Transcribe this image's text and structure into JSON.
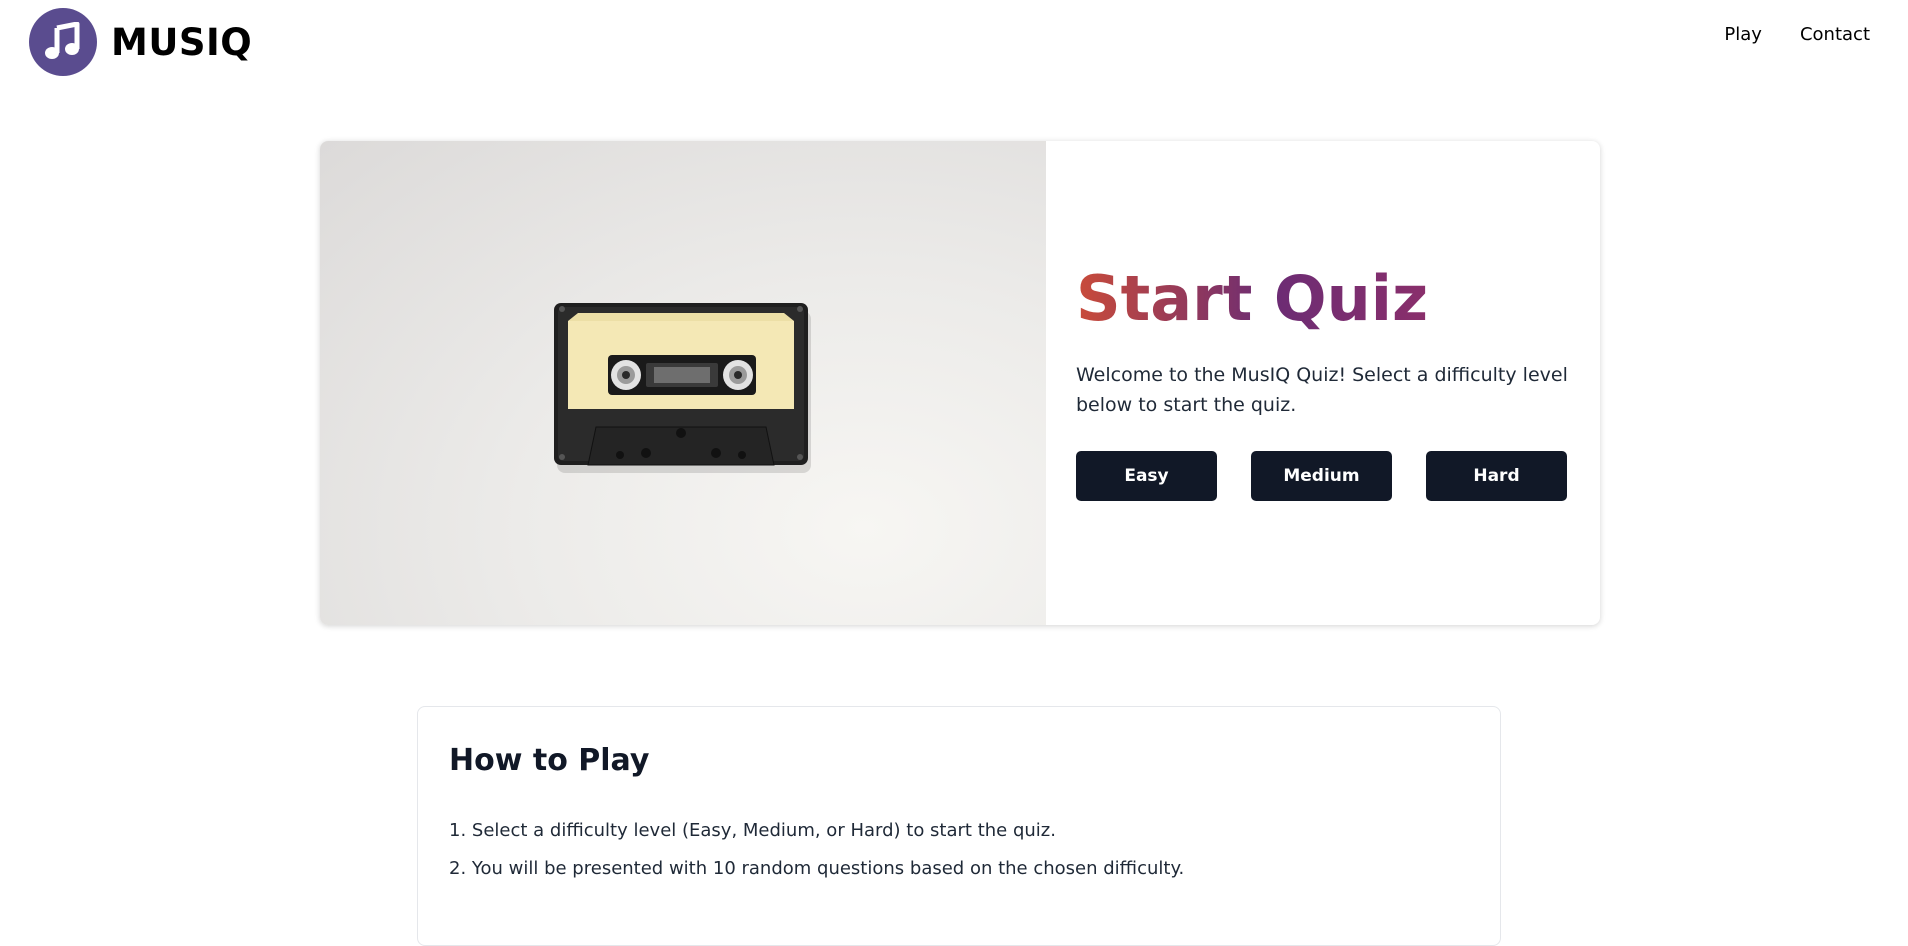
{
  "brand": {
    "name": "MUSIQ",
    "logo_color": "#5a4c8f",
    "logo_icon": "music-note-icon"
  },
  "nav": {
    "play": "Play",
    "contact": "Contact"
  },
  "hero": {
    "title": "Start Quiz",
    "description": "Welcome to the MusIQ Quiz! Select a difficulty level below to start the quiz.",
    "image": "cassette-tape-image",
    "buttons": {
      "easy": "Easy",
      "medium": "Medium",
      "hard": "Hard"
    },
    "button_color": "#111827",
    "title_gradient": [
      "#c94b3a",
      "#6b2c74"
    ]
  },
  "how_to_play": {
    "title": "How to Play",
    "steps": [
      "1. Select a difficulty level (Easy, Medium, or Hard) to start the quiz.",
      "2. You will be presented with 10 random questions based on the chosen difficulty."
    ]
  }
}
